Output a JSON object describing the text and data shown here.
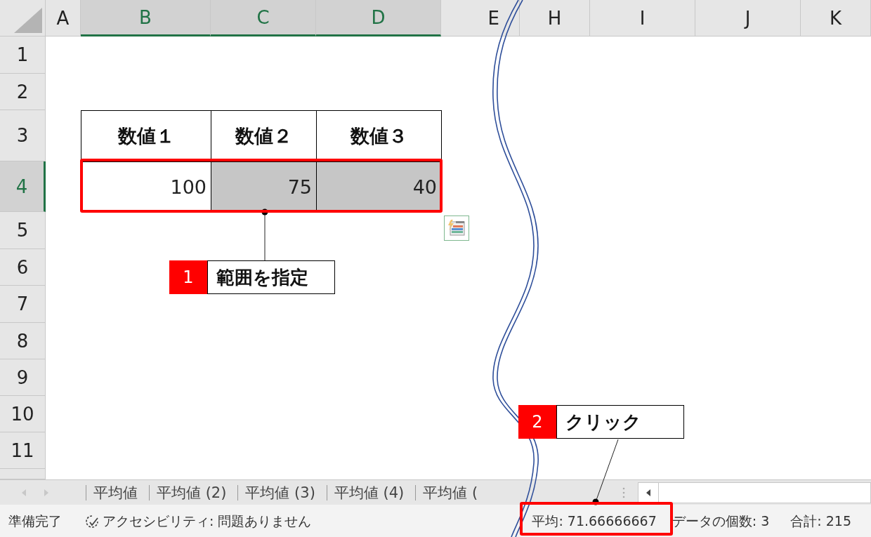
{
  "columns": [
    {
      "label": "A",
      "selected": false
    },
    {
      "label": "B",
      "selected": true
    },
    {
      "label": "C",
      "selected": true
    },
    {
      "label": "D",
      "selected": true
    },
    {
      "label": "E",
      "selected": false
    },
    {
      "label": "H",
      "selected": false
    },
    {
      "label": "I",
      "selected": false
    },
    {
      "label": "J",
      "selected": false
    },
    {
      "label": "K",
      "selected": false
    }
  ],
  "rows": [
    {
      "label": "1",
      "selected": false
    },
    {
      "label": "2",
      "selected": false
    },
    {
      "label": "3",
      "selected": false
    },
    {
      "label": "4",
      "selected": true
    },
    {
      "label": "5",
      "selected": false
    },
    {
      "label": "6",
      "selected": false
    },
    {
      "label": "7",
      "selected": false
    },
    {
      "label": "8",
      "selected": false
    },
    {
      "label": "9",
      "selected": false
    },
    {
      "label": "10",
      "selected": false
    },
    {
      "label": "11",
      "selected": false
    }
  ],
  "table": {
    "headers": [
      "数値１",
      "数値２",
      "数値３"
    ],
    "cells": [
      {
        "value": "100",
        "highlighted": false
      },
      {
        "value": "75",
        "highlighted": true
      },
      {
        "value": "40",
        "highlighted": true
      }
    ]
  },
  "callouts": [
    {
      "number": "1",
      "text": "範囲を指定"
    },
    {
      "number": "2",
      "text": "クリック"
    }
  ],
  "sheet_tabs": [
    "平均値",
    "平均値 (2)",
    "平均値 (3)",
    "平均値 (4)",
    "平均値 ("
  ],
  "status_bar": {
    "ready": "準備完了",
    "accessibility": "アクセシビリティ: 問題ありません",
    "average": "平均: 71.66666667",
    "count": "データの個数: 3",
    "sum": "合計: 215"
  }
}
